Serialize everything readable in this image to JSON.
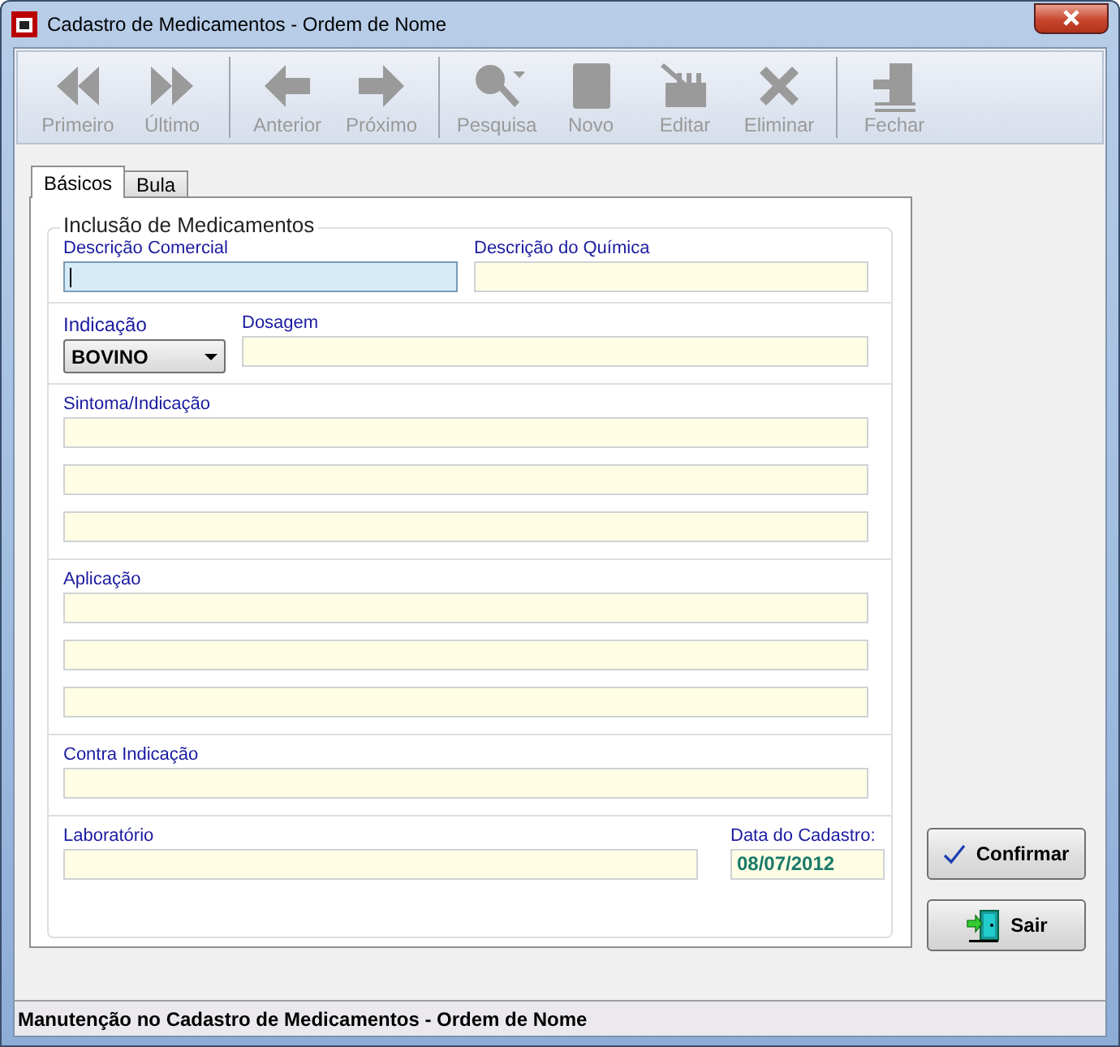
{
  "window": {
    "title": "Cadastro de Medicamentos - Ordem de Nome"
  },
  "toolbar": [
    {
      "kind": "first",
      "label": "Primeiro",
      "disabled": true
    },
    {
      "kind": "last",
      "label": "Último",
      "disabled": true
    },
    {
      "kind": "sep"
    },
    {
      "kind": "prev",
      "label": "Anterior",
      "disabled": true
    },
    {
      "kind": "next",
      "label": "Próximo",
      "disabled": true
    },
    {
      "kind": "sep"
    },
    {
      "kind": "search",
      "label": "Pesquisa",
      "disabled": true
    },
    {
      "kind": "new",
      "label": "Novo",
      "disabled": true
    },
    {
      "kind": "edit",
      "label": "Editar",
      "disabled": true
    },
    {
      "kind": "delete",
      "label": "Eliminar",
      "disabled": true
    },
    {
      "kind": "sep"
    },
    {
      "kind": "close",
      "label": "Fechar",
      "disabled": true
    }
  ],
  "tabs": [
    {
      "label": "Básicos",
      "selected": true
    },
    {
      "label": "Bula",
      "selected": false
    }
  ],
  "group": {
    "title": "Inclusão de Medicamentos"
  },
  "sections": [
    {
      "kind": "pair",
      "fields": [
        {
          "kind": "text",
          "label": "Descrição Comercial",
          "focused": true
        },
        {
          "kind": "text",
          "label": "Descrição do Química",
          "focused": false
        }
      ]
    },
    {
      "kind": "pair",
      "fields": [
        {
          "kind": "select",
          "label": "Indicação",
          "value": "BOVINO"
        },
        {
          "kind": "text",
          "label": "Dosagem",
          "focused": false
        }
      ]
    },
    {
      "kind": "multi",
      "label": "Sintoma/Indicação",
      "lines": [
        {
          "focused": false
        },
        {
          "focused": false
        },
        {
          "focused": false
        }
      ]
    },
    {
      "kind": "multi",
      "label": "Aplicação",
      "lines": [
        {
          "focused": false
        },
        {
          "focused": false
        },
        {
          "focused": false
        }
      ]
    },
    {
      "kind": "multi",
      "label": "Contra Indicação",
      "lines": [
        {
          "focused": false
        }
      ]
    },
    {
      "kind": "pair",
      "fields": [
        {
          "kind": "text",
          "label": "Laboratório",
          "focused": false
        },
        {
          "kind": "date",
          "label": "Data do Cadastro:",
          "value": "08/07/2012"
        }
      ]
    }
  ],
  "buttons": [
    {
      "kind": "confirm",
      "label": "Confirmar"
    },
    {
      "kind": "exit",
      "label": "Sair"
    }
  ],
  "status_bar": "Manutenção no Cadastro de Medicamentos - Ordem de Nome"
}
